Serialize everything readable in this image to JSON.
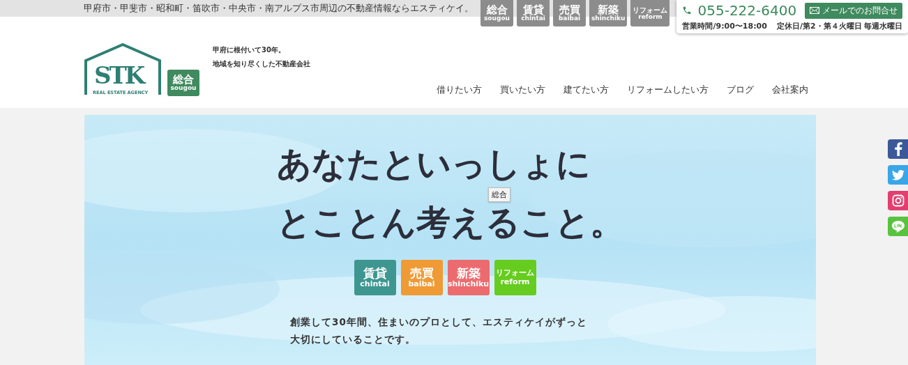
{
  "top_bar": {
    "tagline": "甲府市・甲斐市・昭和町・笛吹市・中央市・南アルプス市周辺の不動産情報ならエスティケイ。"
  },
  "top_categories": [
    {
      "kanji": "総合",
      "romaji": "sougou"
    },
    {
      "kanji": "賃貸",
      "romaji": "chintai"
    },
    {
      "kanji": "売買",
      "romaji": "baibai"
    },
    {
      "kanji": "新築",
      "romaji": "shinchiku"
    },
    {
      "kanji": "リフォーム",
      "romaji": "reform"
    }
  ],
  "contact": {
    "phone": "055-222-6400",
    "mail_button": "メールでのお問合せ",
    "hours": "営業時間/9:00〜18:00",
    "holiday": "定休日/第2・第４火曜日 毎週水曜日"
  },
  "logo": {
    "mark": "STK",
    "subtitle": "REAL ESTATE AGENCY"
  },
  "badge": {
    "kanji": "総合",
    "romaji": "sougou"
  },
  "tagline": [
    "甲府に根付いて30年。",
    "地域を知り尽くした不動産会社"
  ],
  "nav": [
    "借りたい方",
    "買いたい方",
    "建てたい方",
    "リフォームしたい方",
    "ブログ",
    "会社案内"
  ],
  "hero": {
    "headline": [
      "あなたといっしょに",
      "とことん考えること。"
    ],
    "categories": [
      {
        "kanji": "賃貸",
        "romaji": "chintai",
        "color": "#3e9691"
      },
      {
        "kanji": "売買",
        "romaji": "baibai",
        "color": "#ef9a35"
      },
      {
        "kanji": "新築",
        "romaji": "shinchiku",
        "color": "#ec6b6f"
      },
      {
        "kanji": "リフォーム",
        "romaji": "reform",
        "color": "#66cc1f"
      }
    ],
    "description": [
      "創業して30年間、住まいのプロとして、エスティケイがずっと",
      "大切にしていることです。"
    ]
  },
  "tooltip": "総合",
  "social": [
    {
      "kind": "facebook"
    },
    {
      "kind": "twitter"
    },
    {
      "kind": "instagram"
    },
    {
      "kind": "line"
    }
  ]
}
